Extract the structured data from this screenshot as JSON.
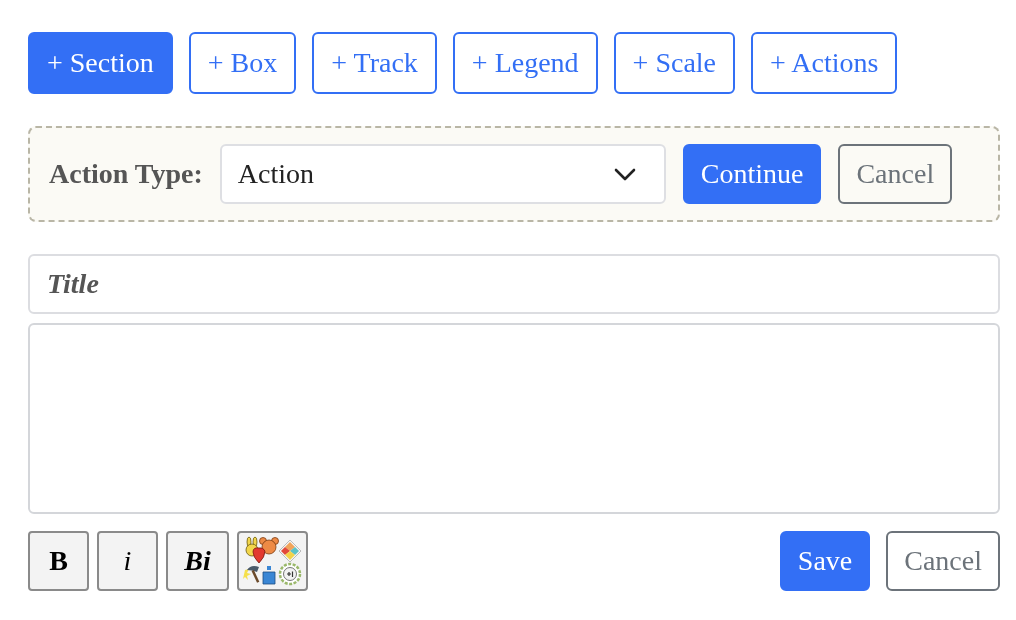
{
  "add_buttons": [
    {
      "label": "+ Section",
      "selected": true
    },
    {
      "label": "+ Box",
      "selected": false
    },
    {
      "label": "+ Track",
      "selected": false
    },
    {
      "label": "+ Legend",
      "selected": false
    },
    {
      "label": "+ Scale",
      "selected": false
    },
    {
      "label": "+ Actions",
      "selected": false
    }
  ],
  "action_panel": {
    "label": "Action Type:",
    "select": {
      "value": "Action"
    },
    "buttons": [
      {
        "label": "Continue",
        "kind": "primary"
      },
      {
        "label": "Cancel",
        "kind": "secondary"
      }
    ]
  },
  "title_field": {
    "placeholder": "Title"
  },
  "format_buttons": [
    {
      "kind": "bold",
      "label": "B"
    },
    {
      "kind": "italic",
      "label": "i"
    },
    {
      "kind": "bold_italic",
      "label": "Bi"
    },
    {
      "kind": "icons"
    }
  ],
  "form_buttons": [
    {
      "label": "Save",
      "kind": "primary"
    },
    {
      "label": "Cancel",
      "kind": "secondary"
    }
  ]
}
